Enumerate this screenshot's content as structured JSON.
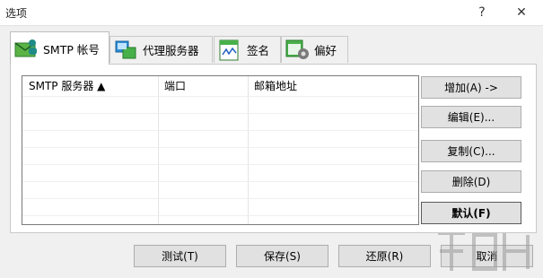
{
  "window": {
    "title": "选项",
    "help_glyph": "?",
    "close_glyph": "✕"
  },
  "tabs": [
    {
      "label": "SMTP 帐号",
      "icon": "smtp-account-icon",
      "active": true
    },
    {
      "label": "代理服务器",
      "icon": "proxy-server-icon",
      "active": false
    },
    {
      "label": "签名",
      "icon": "signature-icon",
      "active": false
    },
    {
      "label": "偏好",
      "icon": "preferences-icon",
      "active": false
    }
  ],
  "table": {
    "columns": [
      "SMTP 服务器 ▲",
      "端口",
      "邮箱地址"
    ],
    "rows": []
  },
  "side_buttons": {
    "add": "增加(A) ->",
    "edit": "编辑(E)...",
    "copy": "复制(C)...",
    "delete": "删除(D)",
    "default": "默认(F)"
  },
  "bottom_buttons": {
    "test": "测试(T)",
    "save": "保存(S)",
    "restore": "还原(R)",
    "cancel": "取消"
  },
  "colors": {
    "accent_green": "#2e9b3a",
    "accent_teal": "#1f8a86",
    "button_face": "#e1e1e1"
  }
}
